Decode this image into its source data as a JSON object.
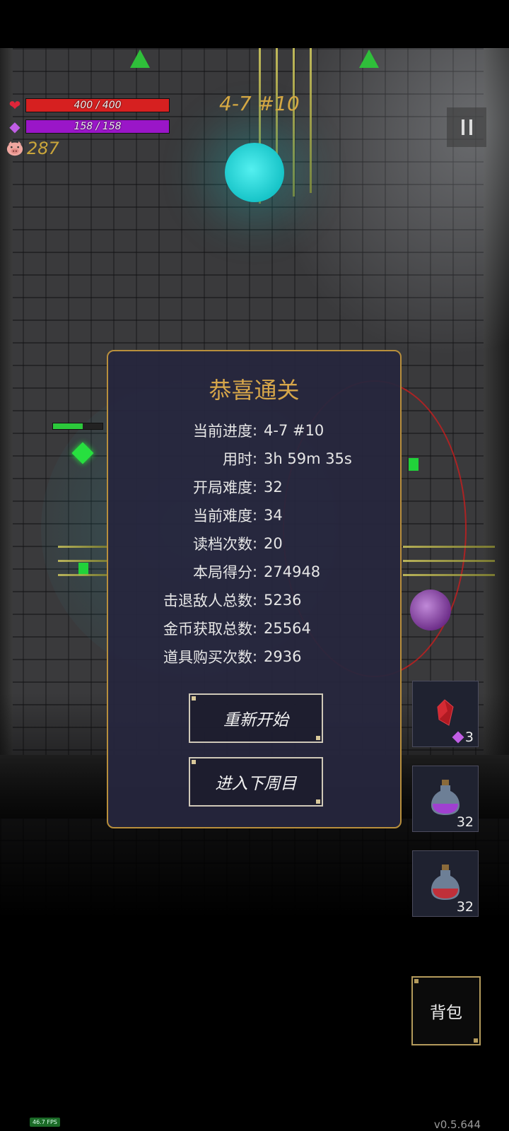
{
  "hud": {
    "hp_text": "400 / 400",
    "mp_text": "158 / 158",
    "gold": "287",
    "stage": "4-7 #10",
    "icons": {
      "hp": "heart-icon",
      "mp": "gem-icon",
      "gold": "pig-icon",
      "pause": "pause-icon"
    }
  },
  "modal": {
    "title": "恭喜通关",
    "stats": [
      {
        "label": "当前进度",
        "value": "4-7 #10"
      },
      {
        "label": "用时",
        "value": "3h 59m 35s"
      },
      {
        "label": "开局难度",
        "value": "32"
      },
      {
        "label": "当前难度",
        "value": "34"
      },
      {
        "label": "读档次数",
        "value": "20"
      },
      {
        "label": "本局得分",
        "value": "274948"
      },
      {
        "label": "击退敌人总数",
        "value": "5236"
      },
      {
        "label": "金币获取总数",
        "value": "25564"
      },
      {
        "label": "道具购买次数",
        "value": "2936"
      }
    ],
    "restart_label": "重新开始",
    "next_cycle_label": "进入下周目"
  },
  "items": [
    {
      "icon": "red-crystal-icon",
      "count": "3",
      "cost_icon": "gem-icon"
    },
    {
      "icon": "mana-potion-icon",
      "count": "32"
    },
    {
      "icon": "health-potion-icon",
      "count": "32"
    }
  ],
  "bag_label": "背包",
  "fps": "46.7 FPS",
  "version": "v0.5.644",
  "colors": {
    "hp": "#d62020",
    "mp": "#9a16c8",
    "gold": "#c9a53b",
    "accent": "#d6a64a",
    "modal_bg": "#26263e"
  }
}
